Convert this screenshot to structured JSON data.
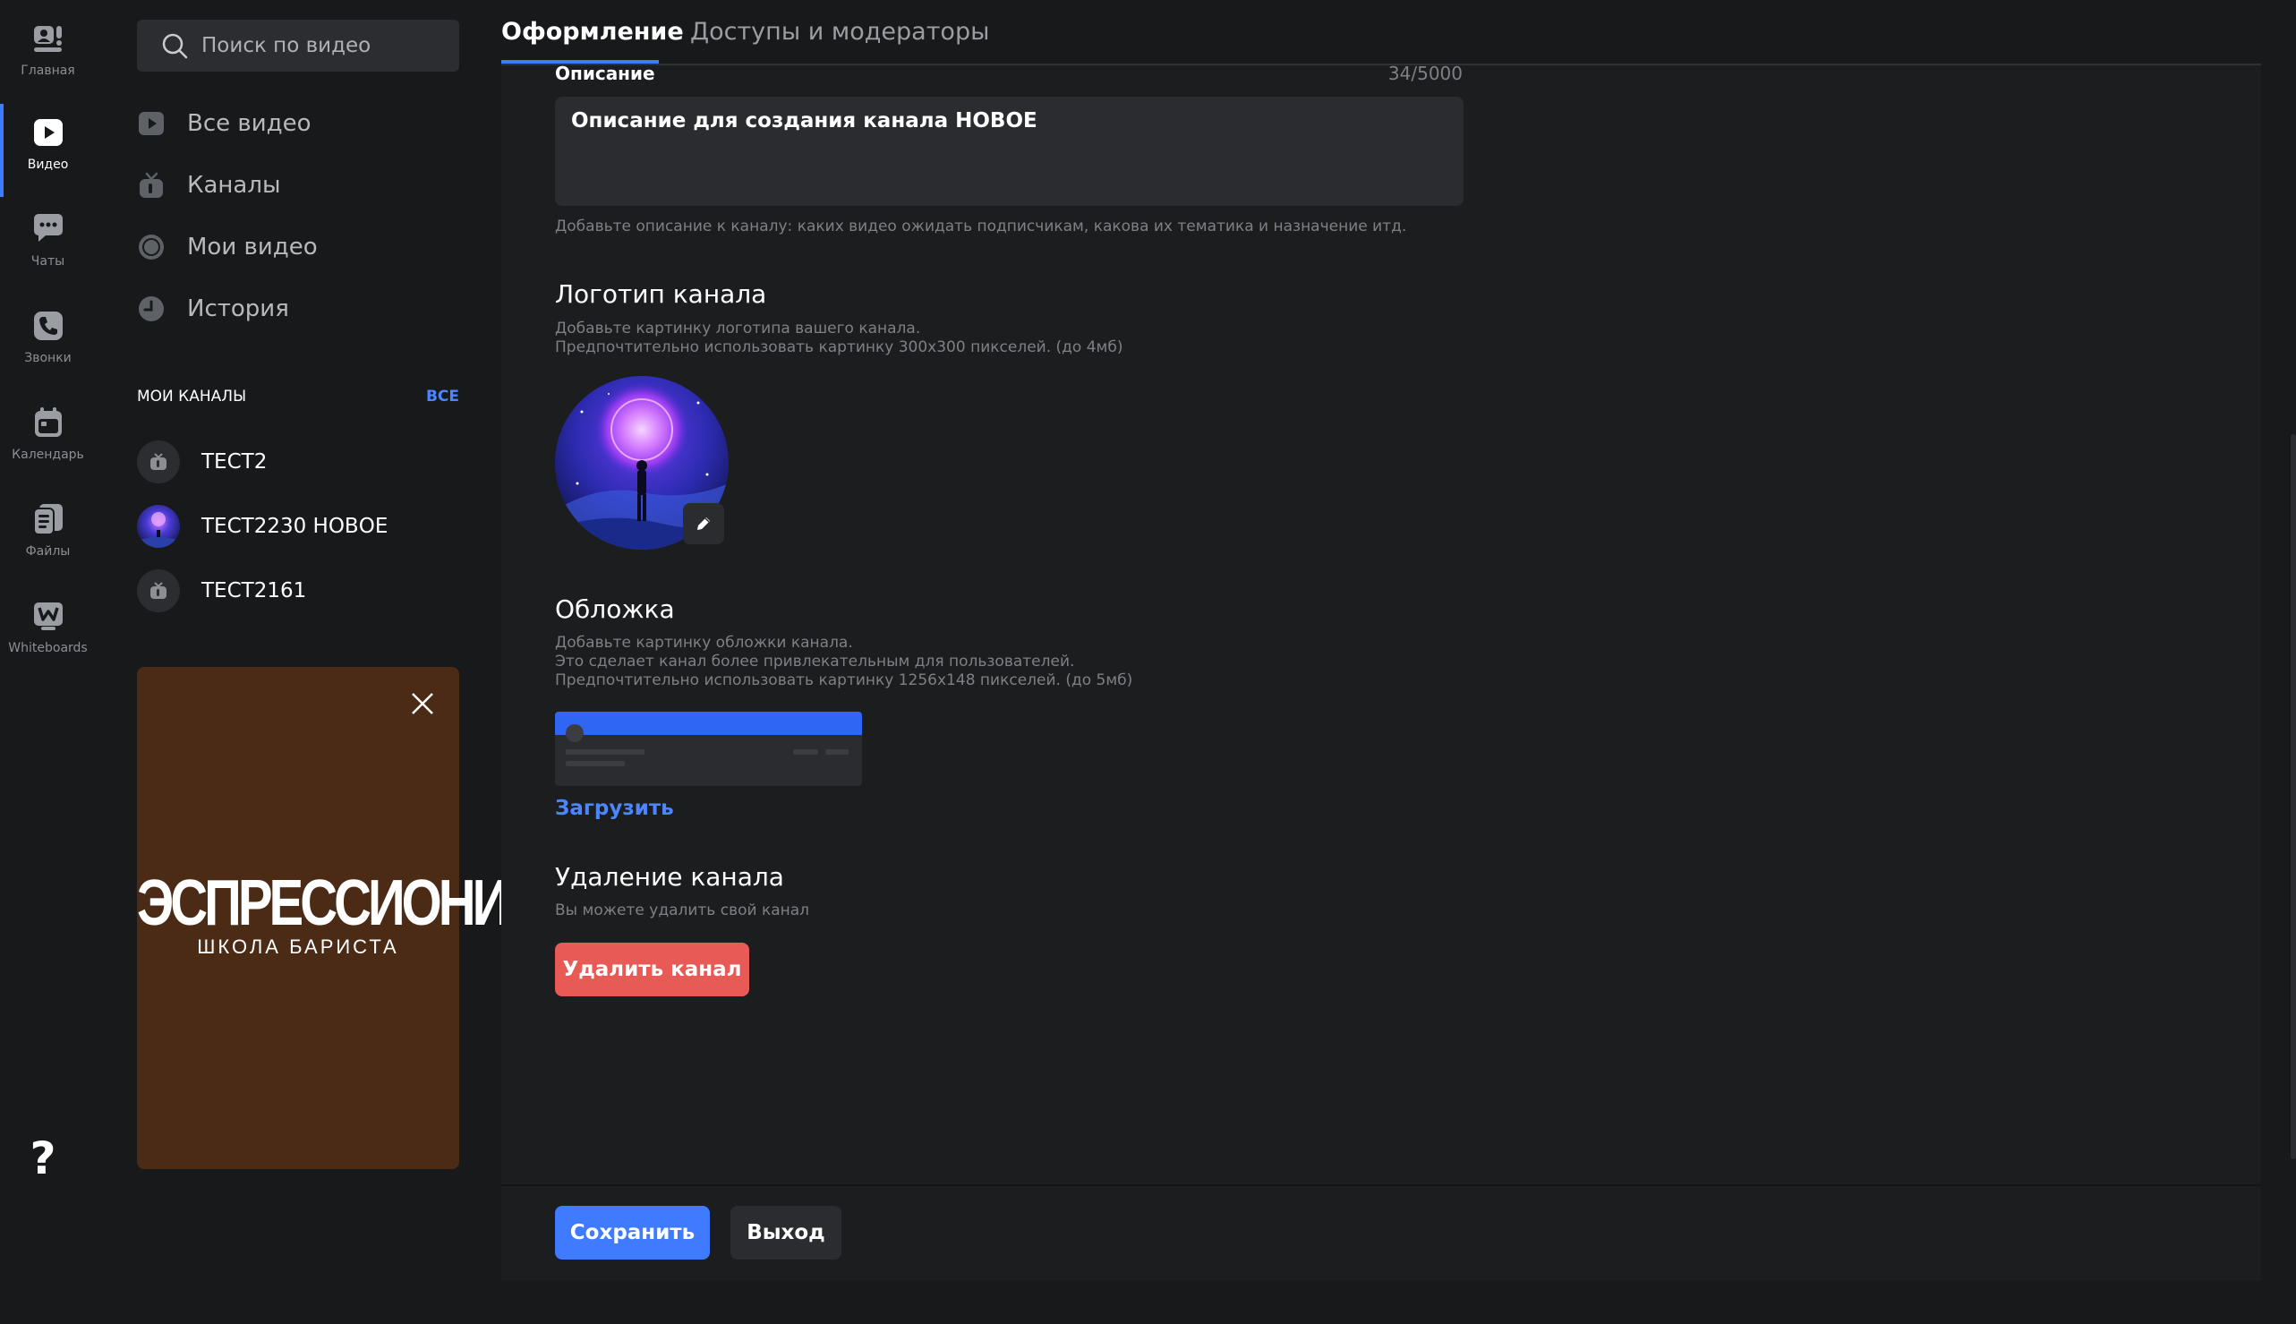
{
  "rail": {
    "items": [
      {
        "label": "Главная",
        "icon": "home-icon"
      },
      {
        "label": "Видео",
        "icon": "video-icon",
        "active": true
      },
      {
        "label": "Чаты",
        "icon": "chat-icon"
      },
      {
        "label": "Звонки",
        "icon": "phone-icon"
      },
      {
        "label": "Календарь",
        "icon": "calendar-icon"
      },
      {
        "label": "Файлы",
        "icon": "files-icon"
      },
      {
        "label": "Whiteboards",
        "icon": "whiteboard-icon"
      }
    ],
    "help": "?"
  },
  "sidebar": {
    "search_placeholder": "Поиск по видео",
    "nav": [
      {
        "label": "Все видео",
        "icon": "play-square-icon"
      },
      {
        "label": "Каналы",
        "icon": "tv-icon"
      },
      {
        "label": "Мои видео",
        "icon": "record-icon"
      },
      {
        "label": "История",
        "icon": "clock-icon"
      }
    ],
    "channels_title": "МОИ КАНАЛЫ",
    "channels_all": "ВСЕ",
    "channels": [
      {
        "name": "ТЕСТ2"
      },
      {
        "name": "ТЕСТ2230 НОВОЕ"
      },
      {
        "name": "ТЕСТ2161"
      }
    ],
    "promo": {
      "brand": "ЭСПРЕССИОНИСТ",
      "subtitle": "ШКОЛА БАРИСТА",
      "background": "#4b2b15"
    }
  },
  "tabs": [
    {
      "label": "Оформление",
      "active": true
    },
    {
      "label": "Доступы и модераторы",
      "active": false
    }
  ],
  "form": {
    "description": {
      "label": "Описание",
      "counter": "34/5000",
      "value": "Описание для создания канала НОВОЕ",
      "hint": "Добавьте описание к каналу: каких видео ожидать подписчикам, какова их тематика и назначение итд."
    },
    "logo": {
      "title": "Логотип канала",
      "hint1": "Добавьте картинку логотипа вашего канала.",
      "hint2": "Предпочтительно использовать картинку 300x300 пикселей. (до 4мб)"
    },
    "cover": {
      "title": "Обложка",
      "hint1": "Добавьте картинку обложки канала.",
      "hint2": "Это сделает канал более привлекательным для пользователей.",
      "hint3": "Предпочтительно использовать картинку 1256x148 пикселей. (до 5мб)",
      "upload": "Загрузить"
    },
    "delete": {
      "title": "Удаление канала",
      "hint": "Вы можете удалить свой канал",
      "button": "Удалить канал"
    }
  },
  "footer": {
    "save": "Сохранить",
    "exit": "Выход"
  },
  "colors": {
    "accent": "#3f7bff",
    "danger": "#e85a55",
    "link": "#4c86ff"
  }
}
